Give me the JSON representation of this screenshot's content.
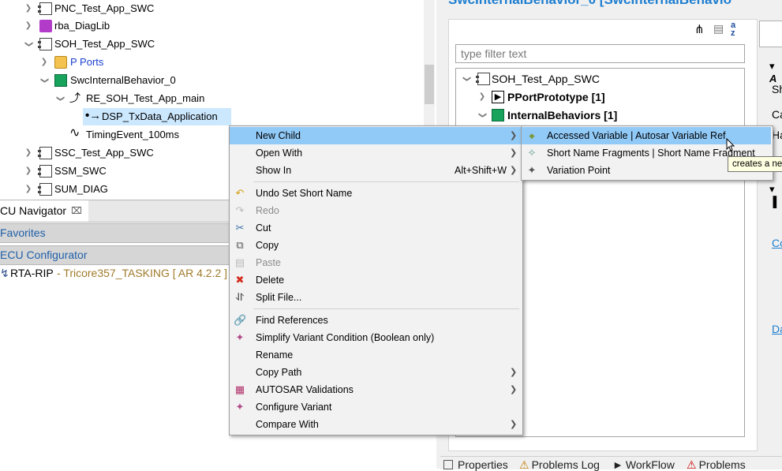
{
  "left_tree": {
    "items": [
      {
        "label": "PNC_Test_App_SWC"
      },
      {
        "label": "rba_DiagLib"
      },
      {
        "label": "SOH_Test_App_SWC"
      },
      {
        "label": "P Ports"
      },
      {
        "label": "SwcInternalBehavior_0"
      },
      {
        "label": "RE_SOH_Test_App_main"
      },
      {
        "label": "DSP_TxData_Application"
      },
      {
        "label": "TimingEvent_100ms"
      },
      {
        "label": "SSC_Test_App_SWC"
      },
      {
        "label": "SSM_SWC"
      },
      {
        "label": "SUM_DIAG"
      }
    ]
  },
  "navigator": {
    "tab_label": "CU Navigator",
    "favorites": "Favorites",
    "ecu_configurator": "ECU Configurator",
    "project_name": "RTA-RIP",
    "project_detail": " - Tricore357_TASKING [ AR 4.2.2 ]"
  },
  "editor": {
    "title": "SwcInternalBehavior_0 [SwcInternalBehavio",
    "filter_placeholder": "type filter text",
    "tree": [
      {
        "label": "SOH_Test_App_SWC"
      },
      {
        "label": "PPortPrototype [1]"
      },
      {
        "label": "InternalBehaviors [1]"
      }
    ],
    "right_cut": [
      "Sh",
      "Ca",
      "Ha",
      "Co",
      "Da"
    ]
  },
  "bottom_tabs": [
    "Properties",
    "Problems Log",
    "WorkFlow",
    "Problems"
  ],
  "context_menu": {
    "items": [
      {
        "label": "New Child",
        "submenu": true,
        "icon": ""
      },
      {
        "label": "Open With",
        "submenu": true,
        "icon": ""
      },
      {
        "label": "Show In",
        "shortcut": "Alt+Shift+W",
        "submenu": true,
        "icon": ""
      },
      {
        "label": "Undo Set Short Name",
        "icon": "undo-icon"
      },
      {
        "label": "Redo",
        "icon": "redo-icon",
        "disabled": true
      },
      {
        "label": "Cut",
        "icon": "scissors-icon"
      },
      {
        "label": "Copy",
        "icon": "copy-icon"
      },
      {
        "label": "Paste",
        "icon": "paste-icon",
        "disabled": true
      },
      {
        "label": "Delete",
        "icon": "delete-icon"
      },
      {
        "label": "Split File...",
        "icon": "split-icon"
      },
      {
        "label": "Find References",
        "icon": "link-icon"
      },
      {
        "label": "Simplify Variant Condition (Boolean only)",
        "icon": "variant-icon"
      },
      {
        "label": "Rename",
        "icon": ""
      },
      {
        "label": "Copy Path",
        "submenu": true,
        "icon": ""
      },
      {
        "label": "AUTOSAR Validations",
        "submenu": true,
        "icon": "validation-icon"
      },
      {
        "label": "Configure Variant",
        "icon": "variant-icon"
      },
      {
        "label": "Compare With",
        "submenu": true,
        "icon": ""
      }
    ]
  },
  "submenu": {
    "items": [
      {
        "label": "Accessed Variable | Autosar Variable Ref"
      },
      {
        "label": "Short Name Fragments | Short Name Fragment"
      },
      {
        "label": "Variation Point"
      }
    ]
  },
  "tooltip": "creates a new",
  "colors": {
    "highlight": "#91c9f7",
    "link": "#1e7ed0",
    "selection": "#cce8ff"
  }
}
